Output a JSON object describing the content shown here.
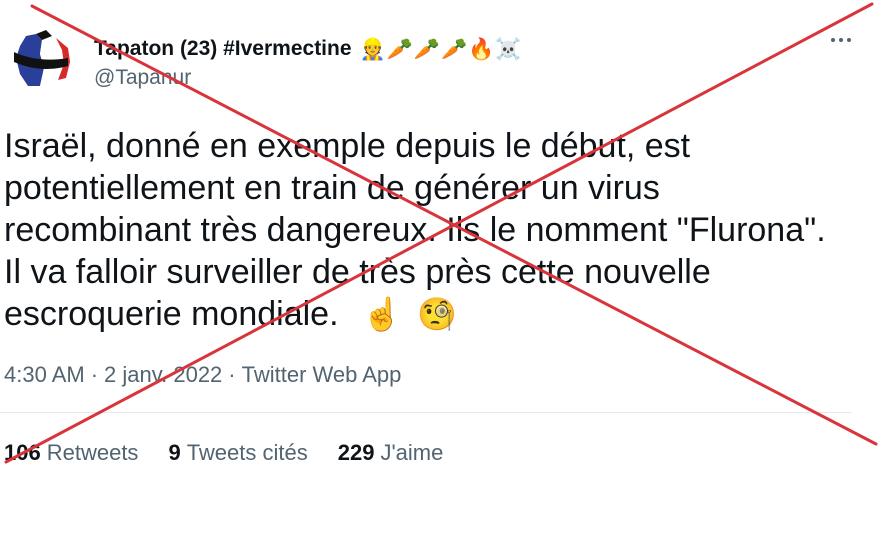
{
  "user": {
    "display_name": "Tapaton (23) #Ivermectine",
    "name_emojis": [
      "👷",
      "🥕",
      "🥕",
      "🥕",
      "🔥",
      "☠️"
    ],
    "handle": "@Tapanur"
  },
  "tweet": {
    "lines": [
      "Israël, donné en exemple depuis le début, est",
      "potentiellement en train de générer un virus",
      "recombinant très dangereux. Ils le nomment \"Flurona\".",
      "Il va falloir surveiller de très près cette nouvelle",
      "escroquerie mondiale."
    ],
    "trailing_emojis": [
      "☝️",
      "🧐"
    ]
  },
  "meta": {
    "time": "4:30 AM",
    "date": "2 janv. 2022",
    "source": "Twitter Web App",
    "separator": "·"
  },
  "stats": {
    "retweets_count": "106",
    "retweets_label": "Retweets",
    "quotes_count": "9",
    "quotes_label": "Tweets cités",
    "likes_count": "229",
    "likes_label": "J'aime"
  },
  "colors": {
    "cross": "#d9343b",
    "secondary_text": "#536471",
    "primary_text": "#0f1419"
  }
}
